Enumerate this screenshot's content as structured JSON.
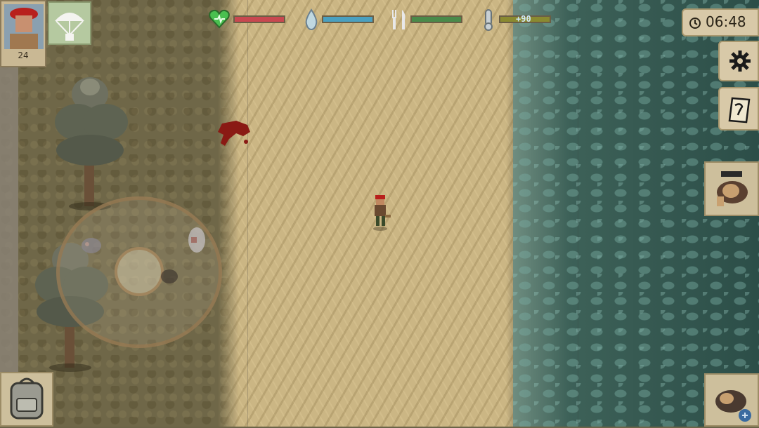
{
  "player": {
    "level": "24"
  },
  "stats": {
    "health": {
      "icon": "heart-icon",
      "level": 1.0,
      "color": "#c84850"
    },
    "thirst": {
      "icon": "water-drop-icon",
      "level": 1.0,
      "color": "#4aa0c0"
    },
    "hunger": {
      "icon": "fork-knife-icon",
      "level": 1.0,
      "color": "#4a8a4a"
    },
    "temperature": {
      "icon": "thermometer-icon",
      "label": "+90",
      "level": 1.0,
      "color": "#8a8a30"
    }
  },
  "clock": {
    "time": "06:48",
    "icon": "clock-icon"
  },
  "buttons": {
    "settings": {
      "icon": "gear-icon"
    },
    "quests": {
      "icon": "notepad-icon"
    },
    "inventory": {
      "icon": "backpack-icon"
    },
    "airdrop": {
      "icon": "parachute-icon"
    },
    "equip_slot_1": {
      "icon": "dog-companion-icon"
    },
    "equip_slot_2": {
      "icon": "dog-command-icon"
    }
  }
}
